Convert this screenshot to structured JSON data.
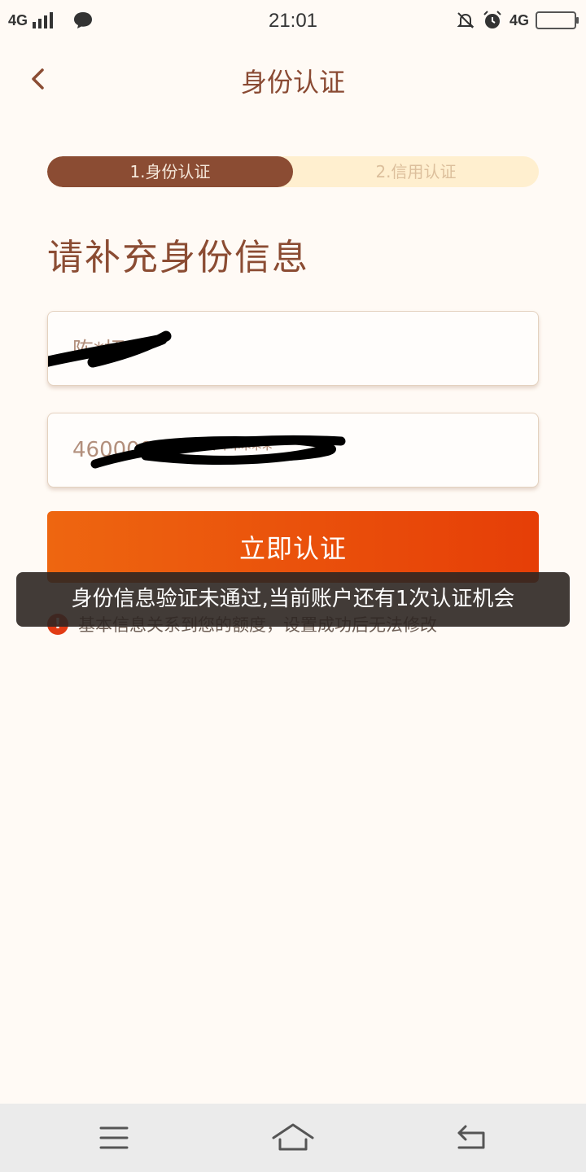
{
  "status_bar": {
    "network_left": "4G",
    "time": "21:01",
    "network_right": "4G"
  },
  "header": {
    "title": "身份认证",
    "back_icon": "chevron-left-icon"
  },
  "steps": [
    {
      "label": "1.身份认证",
      "active": true
    },
    {
      "label": "2.信用认证",
      "active": false
    }
  ],
  "form": {
    "section_title": "请补充身份信息",
    "name_value": "陈*招",
    "id_value": "4600001**********",
    "submit_label": "立即认证"
  },
  "notice": {
    "icon_text": "!",
    "text": "基本信息关系到您的额度，设置成功后无法修改"
  },
  "toast": {
    "text": "身份信息验证未通过,当前账户还有1次认证机会"
  },
  "nav_bar": {
    "icons": [
      "menu-icon",
      "home-icon",
      "back-icon"
    ]
  },
  "colors": {
    "background": "#fffaf5",
    "brand_brown": "#8b4c33",
    "step_inactive_bg": "#ffefcf",
    "button_start": "#ee6610",
    "button_end": "#e63e07",
    "warning_red": "#e23b14"
  }
}
